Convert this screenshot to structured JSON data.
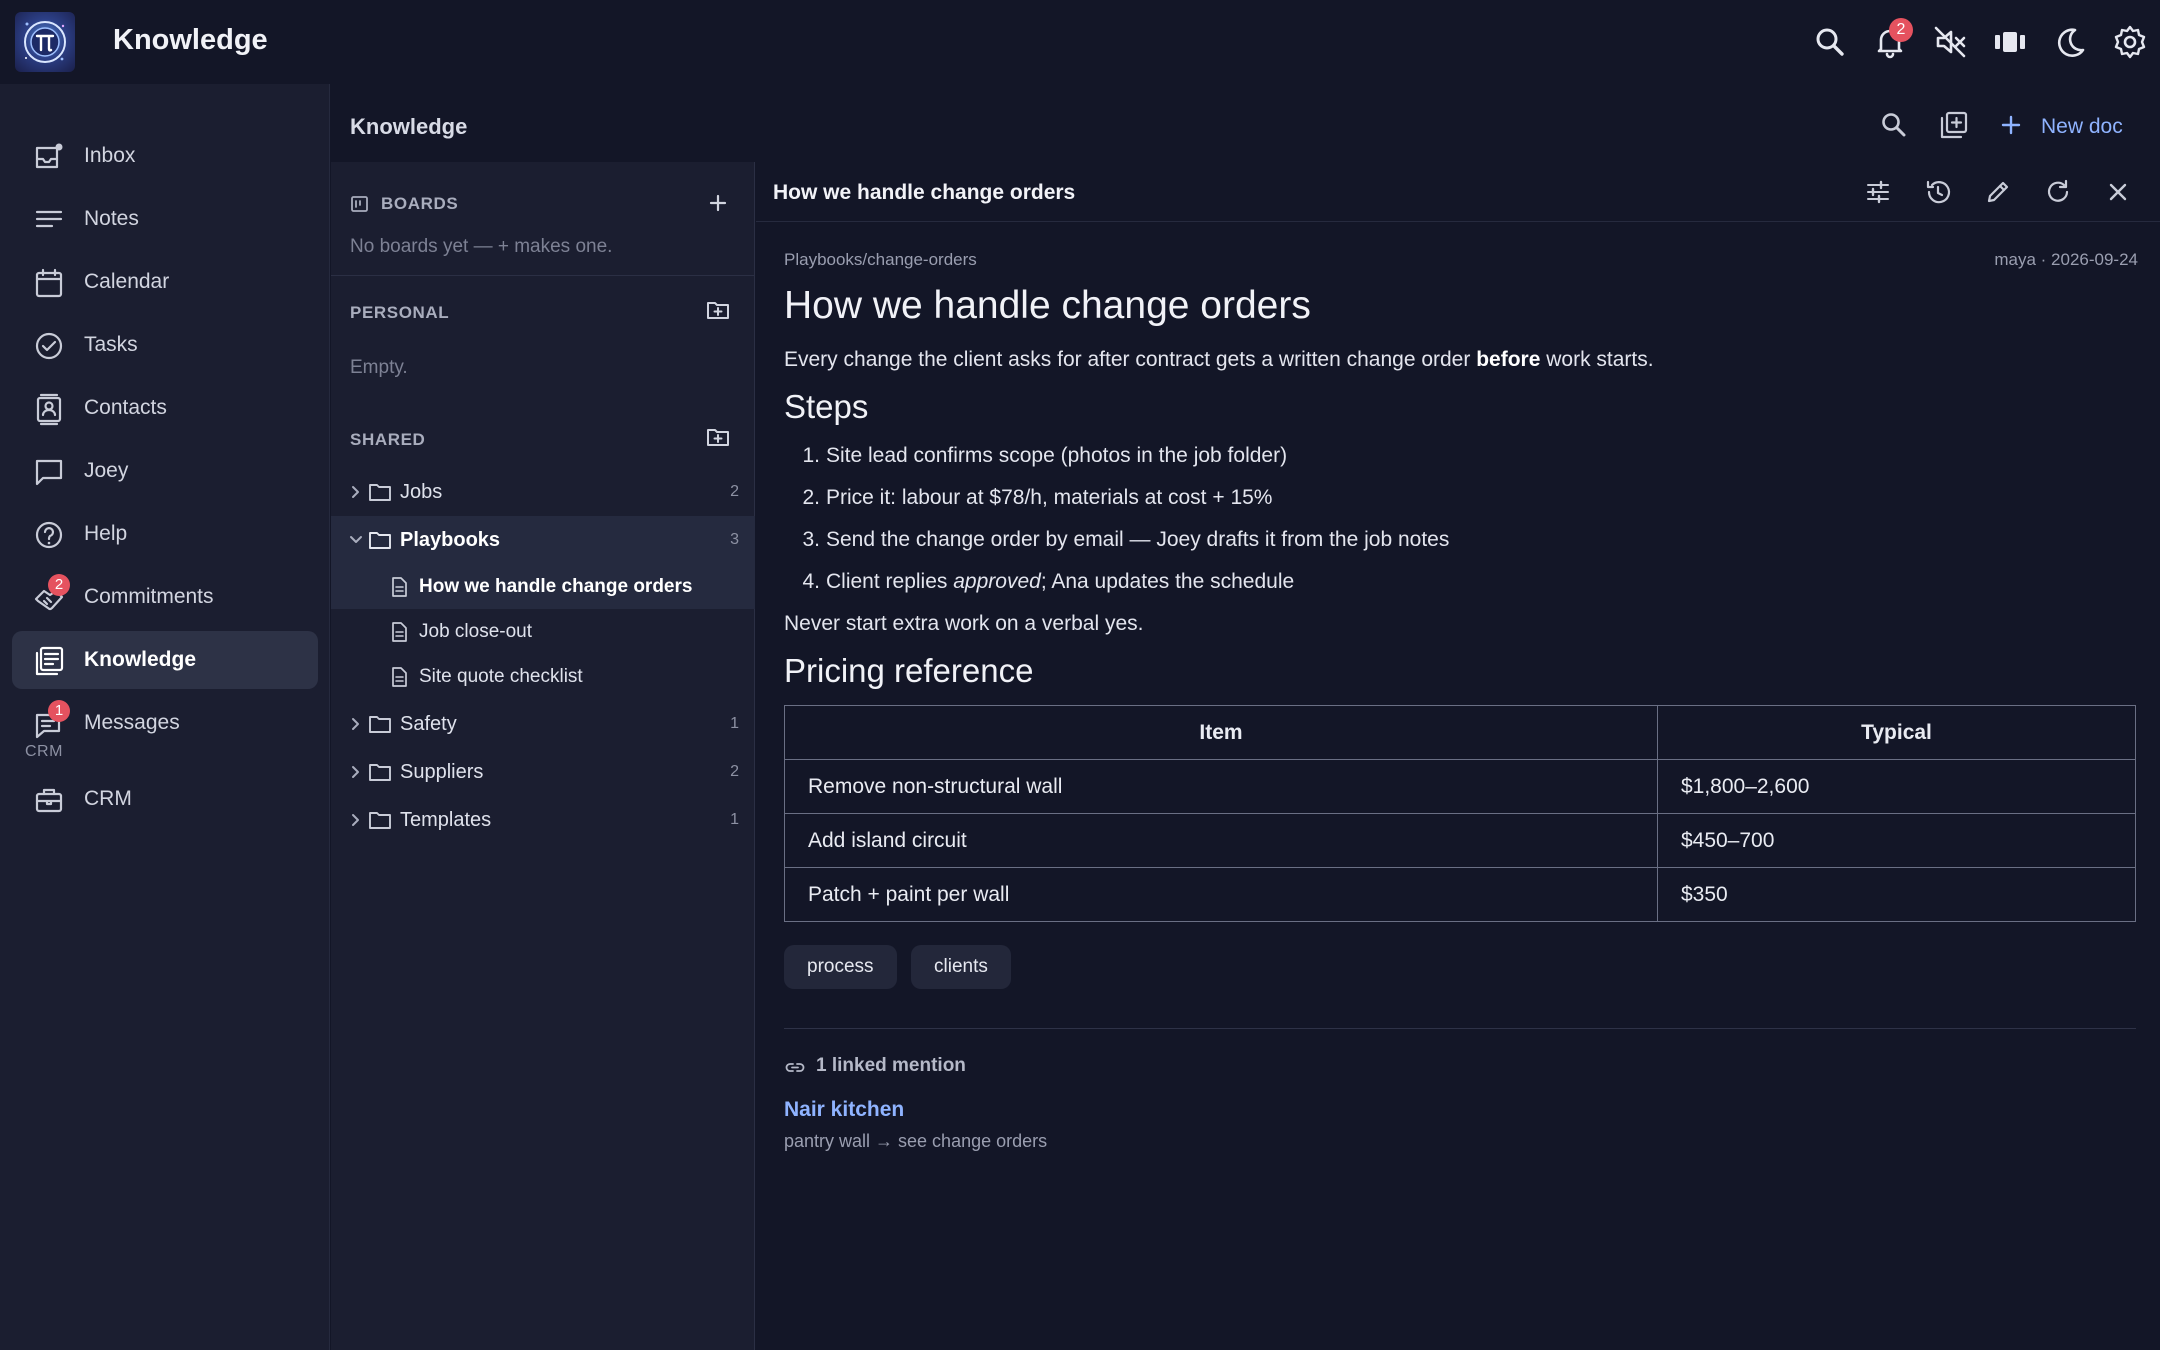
{
  "app": {
    "title": "Knowledge",
    "notification_count": "2"
  },
  "nav": {
    "items": [
      {
        "label": "Inbox",
        "icon": "inbox-icon"
      },
      {
        "label": "Notes",
        "icon": "notes-icon"
      },
      {
        "label": "Calendar",
        "icon": "calendar-icon"
      },
      {
        "label": "Tasks",
        "icon": "tasks-icon"
      },
      {
        "label": "Contacts",
        "icon": "contacts-icon"
      },
      {
        "label": "Joey",
        "icon": "chat-icon"
      },
      {
        "label": "Help",
        "icon": "help-icon"
      },
      {
        "label": "Commitments",
        "icon": "handshake-icon",
        "badge": "2"
      },
      {
        "label": "Knowledge",
        "icon": "knowledge-icon",
        "active": true
      },
      {
        "label": "Messages",
        "icon": "messages-icon",
        "badge": "1"
      }
    ],
    "section_label": "CRM",
    "crm_item": {
      "label": "CRM",
      "icon": "briefcase-icon"
    }
  },
  "knowledge": {
    "header_title": "Knowledge",
    "new_doc_label": "New doc"
  },
  "tree": {
    "boards": {
      "title": "BOARDS",
      "empty": "No boards yet — + makes one."
    },
    "personal": {
      "title": "PERSONAL",
      "empty": "Empty."
    },
    "shared": {
      "title": "SHARED",
      "folders": [
        {
          "label": "Jobs",
          "count": "2"
        },
        {
          "label": "Playbooks",
          "count": "3",
          "open": true
        },
        {
          "label": "Safety",
          "count": "1"
        },
        {
          "label": "Suppliers",
          "count": "2"
        },
        {
          "label": "Templates",
          "count": "1"
        }
      ],
      "playbook_docs": [
        {
          "label": "How we handle change orders",
          "selected": true
        },
        {
          "label": "Job close-out"
        },
        {
          "label": "Site quote checklist"
        }
      ]
    }
  },
  "doc": {
    "toolbar_title": "How we handle change orders",
    "path": "Playbooks/change-orders",
    "meta": "maya · 2026-09-24",
    "title": "How we handle change orders",
    "intro": {
      "before": "Every change the client asks for after contract gets a written change order ",
      "bold": "before",
      "after": " work starts."
    },
    "steps_heading": "Steps",
    "steps": [
      {
        "num": "1.",
        "text": "Site lead confirms scope (photos in the job folder)"
      },
      {
        "num": "2.",
        "text": "Price it: labour at $78/h, materials at cost + 15%"
      },
      {
        "num": "3.",
        "text": "Send the change order by email — Joey drafts it from the job notes"
      },
      {
        "num": "4.",
        "pre": "Client replies ",
        "italic": "approved",
        "post": "; Ana updates the schedule"
      }
    ],
    "rule_text": "Never start extra work on a verbal yes.",
    "pricing_heading": "Pricing reference",
    "table": {
      "headers": [
        "Item",
        "Typical"
      ],
      "rows": [
        [
          "Remove non-structural wall",
          "$1,800–2,600"
        ],
        [
          "Add island circuit",
          "$450–700"
        ],
        [
          "Patch + paint per wall",
          "$350"
        ]
      ]
    },
    "tags": [
      "process",
      "clients"
    ],
    "mentions": {
      "summary": "1 linked mention",
      "link_title": "Nair kitchen",
      "snippet": "pantry wall → see change orders"
    }
  }
}
